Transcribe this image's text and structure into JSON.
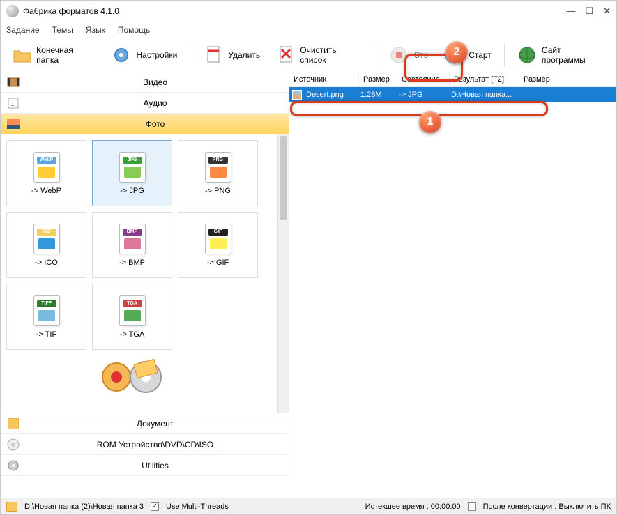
{
  "title": "Фабрика форматов 4.1.0",
  "menu": [
    "Задание",
    "Темы",
    "Язык",
    "Помощь"
  ],
  "toolbar": {
    "output_folder": "Конечная папка",
    "settings": "Настройки",
    "delete": "Удалить",
    "clear_list": "Очистить список",
    "stop": "Сто",
    "start": "Старт",
    "website": "Сайт программы"
  },
  "categories": {
    "video": "Видео",
    "audio": "Аудио",
    "photo": "Фото",
    "document": "Документ",
    "rom": "ROM Устройство\\DVD\\CD\\ISO",
    "utilities": "Utilities"
  },
  "formats": [
    {
      "label": "-> WebP",
      "badge": "WebP",
      "badge_color": "#5aa7e0",
      "inner_color": "#ffcc33"
    },
    {
      "label": "-> JPG",
      "badge": "JPG",
      "badge_color": "#3aa23a",
      "inner_color": "#88cc55"
    },
    {
      "label": "-> PNG",
      "badge": "PNG",
      "badge_color": "#333333",
      "inner_color": "#ff8844"
    },
    {
      "label": "-> ICO",
      "badge": "ICO",
      "badge_color": "#f0d060",
      "inner_color": "#3399dd"
    },
    {
      "label": "-> BMP",
      "badge": "BMP",
      "badge_color": "#8a3a8a",
      "inner_color": "#dd7799"
    },
    {
      "label": "-> GIF",
      "badge": "GIF",
      "badge_color": "#222222",
      "inner_color": "#ffee55"
    },
    {
      "label": "-> TIF",
      "badge": "TIFF",
      "badge_color": "#2a7a2a",
      "inner_color": "#77bbdd"
    },
    {
      "label": "-> TGA",
      "badge": "TGA",
      "badge_color": "#d04040",
      "inner_color": "#55aa55"
    }
  ],
  "columns": {
    "source": "Источник",
    "size": "Размер",
    "state": "Состояние",
    "result": "Результат [F2]",
    "out_size": "Размер"
  },
  "file": {
    "name": "Desert.png",
    "size": "1.28M",
    "state": "-> JPG",
    "result": "D:\\Новая папка..."
  },
  "statusbar": {
    "path": "D:\\Новая папка (2)\\Новая папка 3",
    "multithread": "Use Multi-Threads",
    "elapsed": "Истекшее время : 00:00:00",
    "after": "После конвертации : Выключить ПК"
  },
  "callouts": {
    "one": "1",
    "two": "2"
  }
}
